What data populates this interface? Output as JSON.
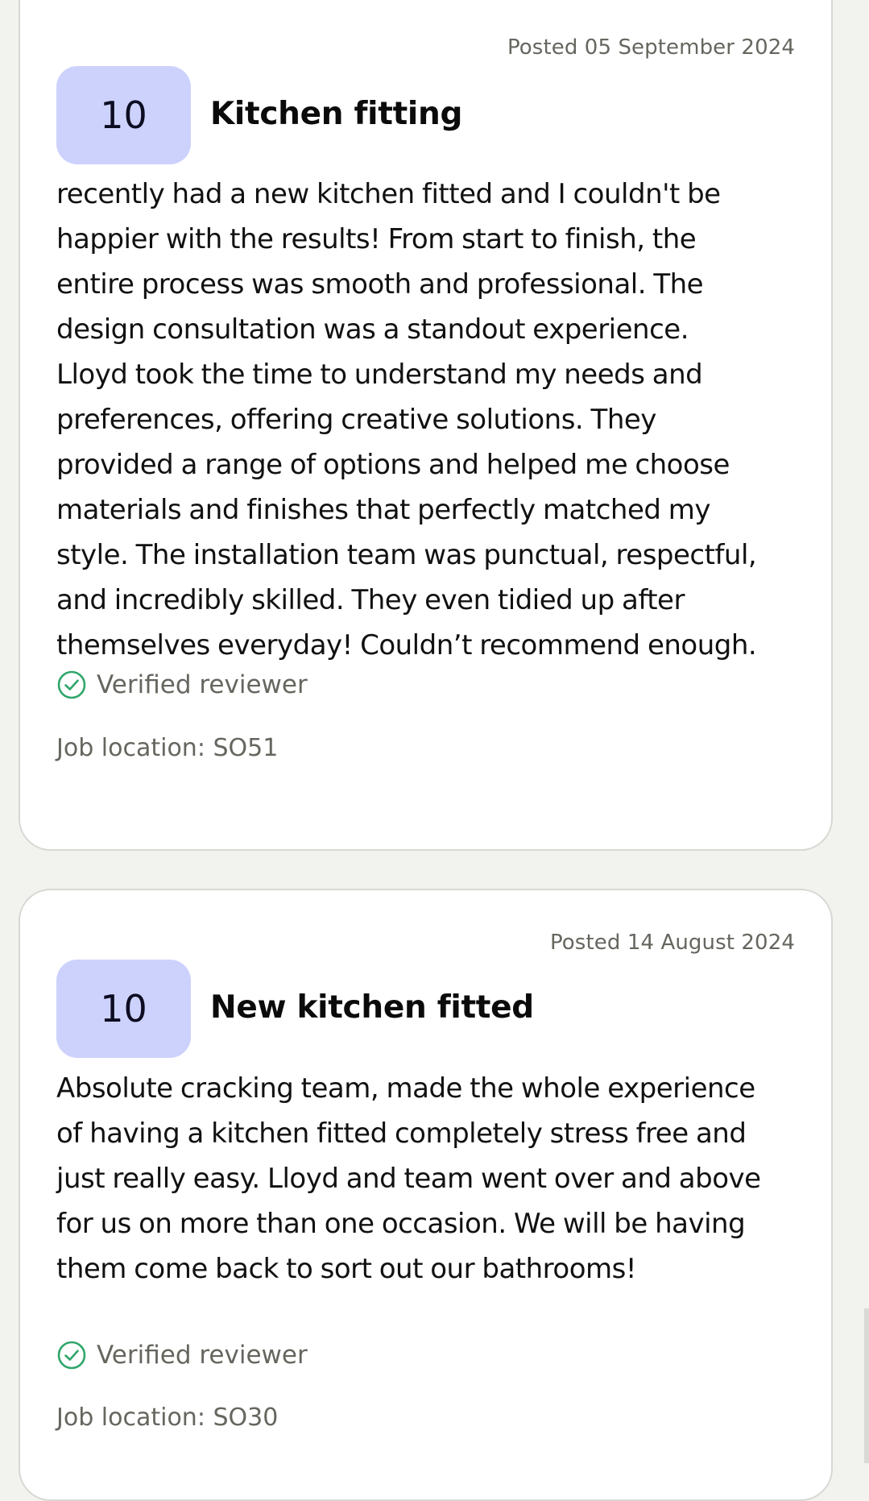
{
  "reviews": [
    {
      "posted": "Posted 05 September 2024",
      "score": "10",
      "title": "Kitchen fitting",
      "body": "recently had a new kitchen fitted and I couldn't be\nhappier with the results! From start to finish, the\nentire process was smooth and professional. The\ndesign consultation was a standout experience.\nLloyd took the time to understand my needs and\npreferences, offering creative solutions. They\nprovided a range of options and helped me choose\nmaterials and finishes that perfectly matched my\nstyle. The installation team was punctual, respectful,\nand incredibly skilled. They even tidied up after\nthemselves everyday! Couldn’t recommend enough.",
      "verified_label": "Verified reviewer",
      "location": "Job location: SO51"
    },
    {
      "posted": "Posted 14 August 2024",
      "score": "10",
      "title": "New kitchen fitted",
      "body": "Absolute cracking team, made the whole experience\nof having a kitchen fitted completely stress free and\njust really easy. Lloyd and team went over and above\nfor us on more than one occasion. We will be having\nthem come back to sort out our bathrooms!",
      "verified_label": "Verified reviewer",
      "location": "Job location: SO30"
    }
  ],
  "icons": {
    "verified": "check-circle-icon"
  },
  "colors": {
    "score_bg": "#cdd2fd",
    "verified_green": "#2fa66a",
    "muted_text": "#66665f"
  }
}
